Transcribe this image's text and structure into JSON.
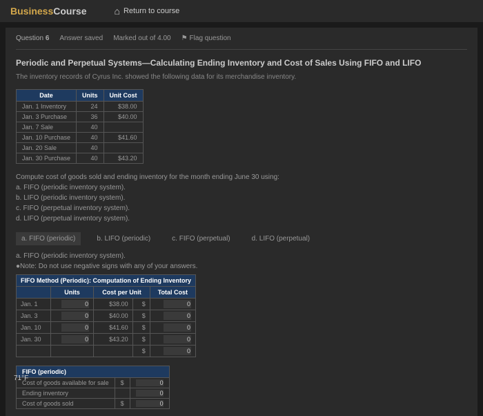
{
  "header": {
    "logo_business": "Business",
    "logo_course": "Course",
    "return_label": "Return to course"
  },
  "question_bar": {
    "label": "Question",
    "number": "6",
    "status": "Answer saved",
    "marked": "Marked out of 4.00",
    "flag": "Flag question"
  },
  "title": "Periodic and Perpetual Systems—Calculating Ending Inventory and Cost of Sales Using FIFO and LIFO",
  "description": "The inventory records of Cyrus Inc. showed the following data for its merchandise inventory.",
  "inv_headers": {
    "date": "Date",
    "units": "Units",
    "cost": "Unit Cost"
  },
  "inv_rows": [
    {
      "date": "Jan. 1 Inventory",
      "units": "24",
      "cost": "$38.00"
    },
    {
      "date": "Jan. 3 Purchase",
      "units": "36",
      "cost": "$40.00"
    },
    {
      "date": "Jan. 7 Sale",
      "units": "40",
      "cost": ""
    },
    {
      "date": "Jan. 10 Purchase",
      "units": "40",
      "cost": "$41.60"
    },
    {
      "date": "Jan. 20 Sale",
      "units": "40",
      "cost": ""
    },
    {
      "date": "Jan. 30 Purchase",
      "units": "40",
      "cost": "$43.20"
    }
  ],
  "compute": {
    "intro": "Compute cost of goods sold and ending inventory for the month ending June 30 using:",
    "a": "a. FIFO (periodic inventory system).",
    "b": "b. LIFO (periodic inventory system).",
    "c": "c. FIFO (perpetual inventory system).",
    "d": "d. LIFO (perpetual inventory system)."
  },
  "tabs": {
    "a": "a. FIFO (periodic)",
    "b": "b. LIFO (periodic)",
    "c": "c. FIFO (perpetual)",
    "d": "d. LIFO (perpetual)"
  },
  "section": {
    "subtitle": "a. FIFO (periodic inventory system).",
    "note": "●Note: Do not use negative signs with any of your answers."
  },
  "fifo_header": "FIFO Method (Periodic): Computation of Ending Inventory",
  "fifo_cols": {
    "blank": "",
    "units": "Units",
    "cpu": "Cost per Unit",
    "total": "Total Cost"
  },
  "fifo_rows": [
    {
      "label": "Jan. 1",
      "units": "0",
      "cost": "$38.00",
      "total": "0"
    },
    {
      "label": "Jan. 3",
      "units": "0",
      "cost": "$40.00",
      "total": "0"
    },
    {
      "label": "Jan. 10",
      "units": "0",
      "cost": "$41.60",
      "total": "0"
    },
    {
      "label": "Jan. 30",
      "units": "0",
      "cost": "$43.20",
      "total": "0"
    }
  ],
  "fifo_total": "0",
  "summary_header": "FIFO (periodic)",
  "summary": [
    {
      "label": "Cost of goods available for sale",
      "dollar": "$",
      "val": "0"
    },
    {
      "label": "Ending inventory",
      "dollar": "",
      "val": "0"
    },
    {
      "label": "Cost of goods sold",
      "dollar": "$",
      "val": "0"
    }
  ],
  "temp": "71°F"
}
